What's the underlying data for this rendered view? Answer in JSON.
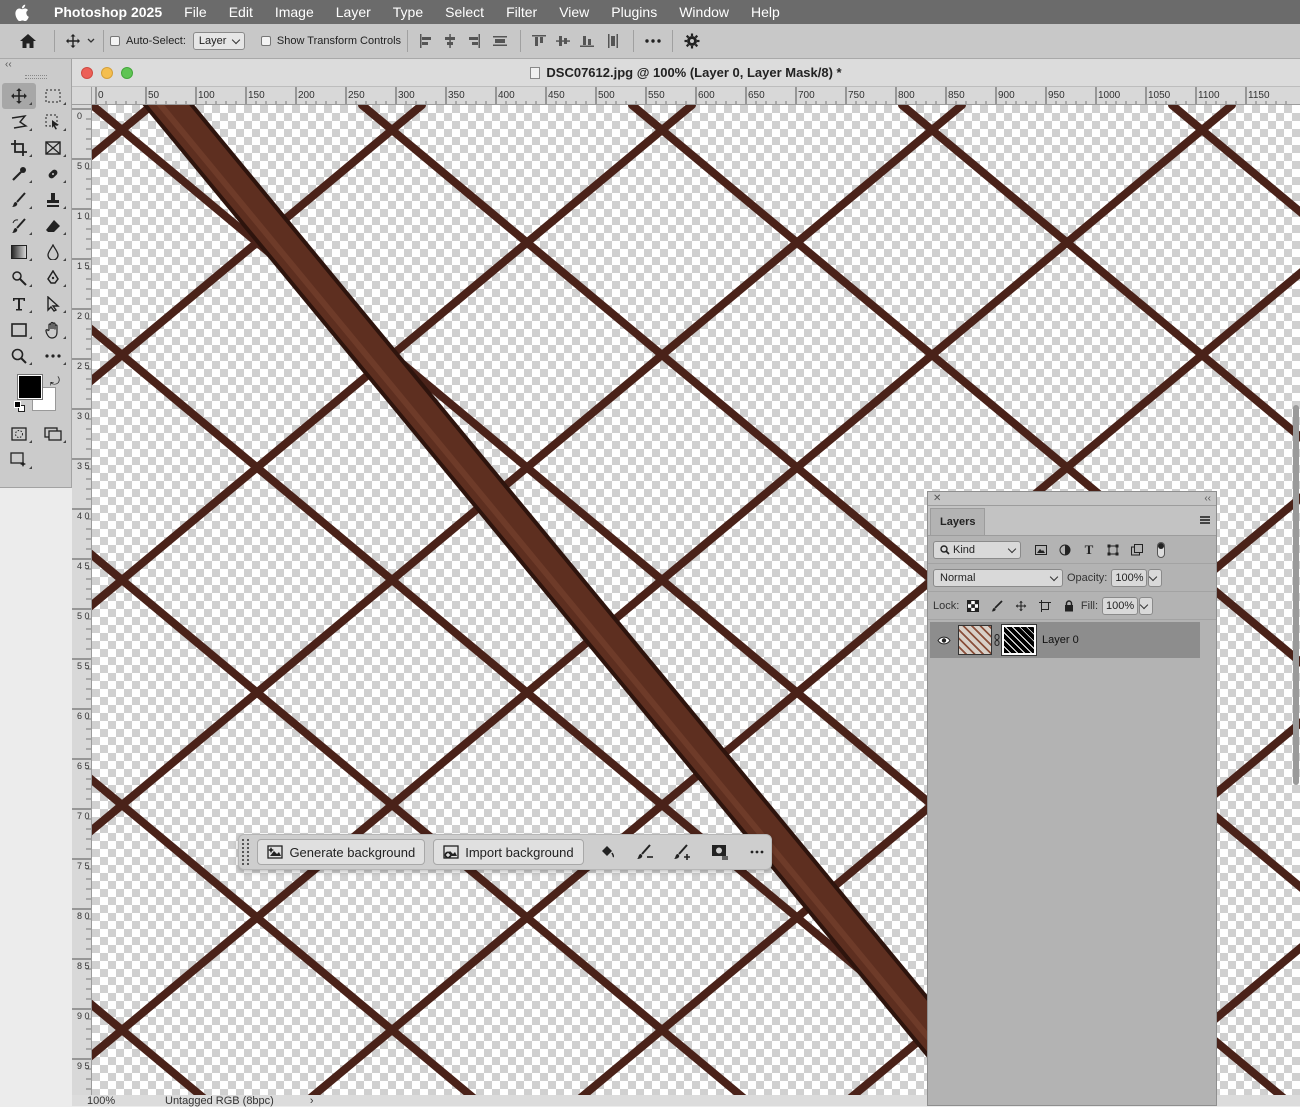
{
  "menubar": {
    "app_name": "Photoshop 2025",
    "items": [
      "File",
      "Edit",
      "Image",
      "Layer",
      "Type",
      "Select",
      "Filter",
      "View",
      "Plugins",
      "Window",
      "Help"
    ]
  },
  "options_bar": {
    "auto_select_label": "Auto-Select:",
    "auto_select_value": "Layer",
    "show_transform_label": "Show Transform Controls"
  },
  "document": {
    "title": "DSC07612.jpg @ 100% (Layer 0, Layer Mask/8) *",
    "ruler_h_ticks": [
      "0",
      "50",
      "100",
      "150",
      "200",
      "250",
      "300",
      "350",
      "400",
      "450",
      "500",
      "550",
      "600",
      "650",
      "700",
      "750",
      "800",
      "850",
      "900",
      "950",
      "1000",
      "1050",
      "1100",
      "1150"
    ],
    "ruler_v_ticks": [
      "0",
      "50",
      "100",
      "150",
      "200",
      "250",
      "300",
      "350",
      "400",
      "450",
      "500",
      "550",
      "600",
      "650",
      "700",
      "750",
      "800",
      "850",
      "900",
      "950"
    ],
    "zoom": "100%",
    "color_profile": "Untagged RGB (8bpc)"
  },
  "taskbar": {
    "generate_label": "Generate background",
    "import_label": "Import background"
  },
  "layers_panel": {
    "tab_label": "Layers",
    "filter_kind": "Kind",
    "blend_mode": "Normal",
    "opacity_label": "Opacity:",
    "opacity_value": "100%",
    "lock_label": "Lock:",
    "fill_label": "Fill:",
    "fill_value": "100%",
    "layers": [
      {
        "name": "Layer 0",
        "visible": true,
        "has_mask": true
      }
    ]
  },
  "colors": {
    "foreground": "#000000",
    "background": "#ffffff",
    "fence_wire": "#4a2219",
    "pipe": "#5e2f20"
  }
}
